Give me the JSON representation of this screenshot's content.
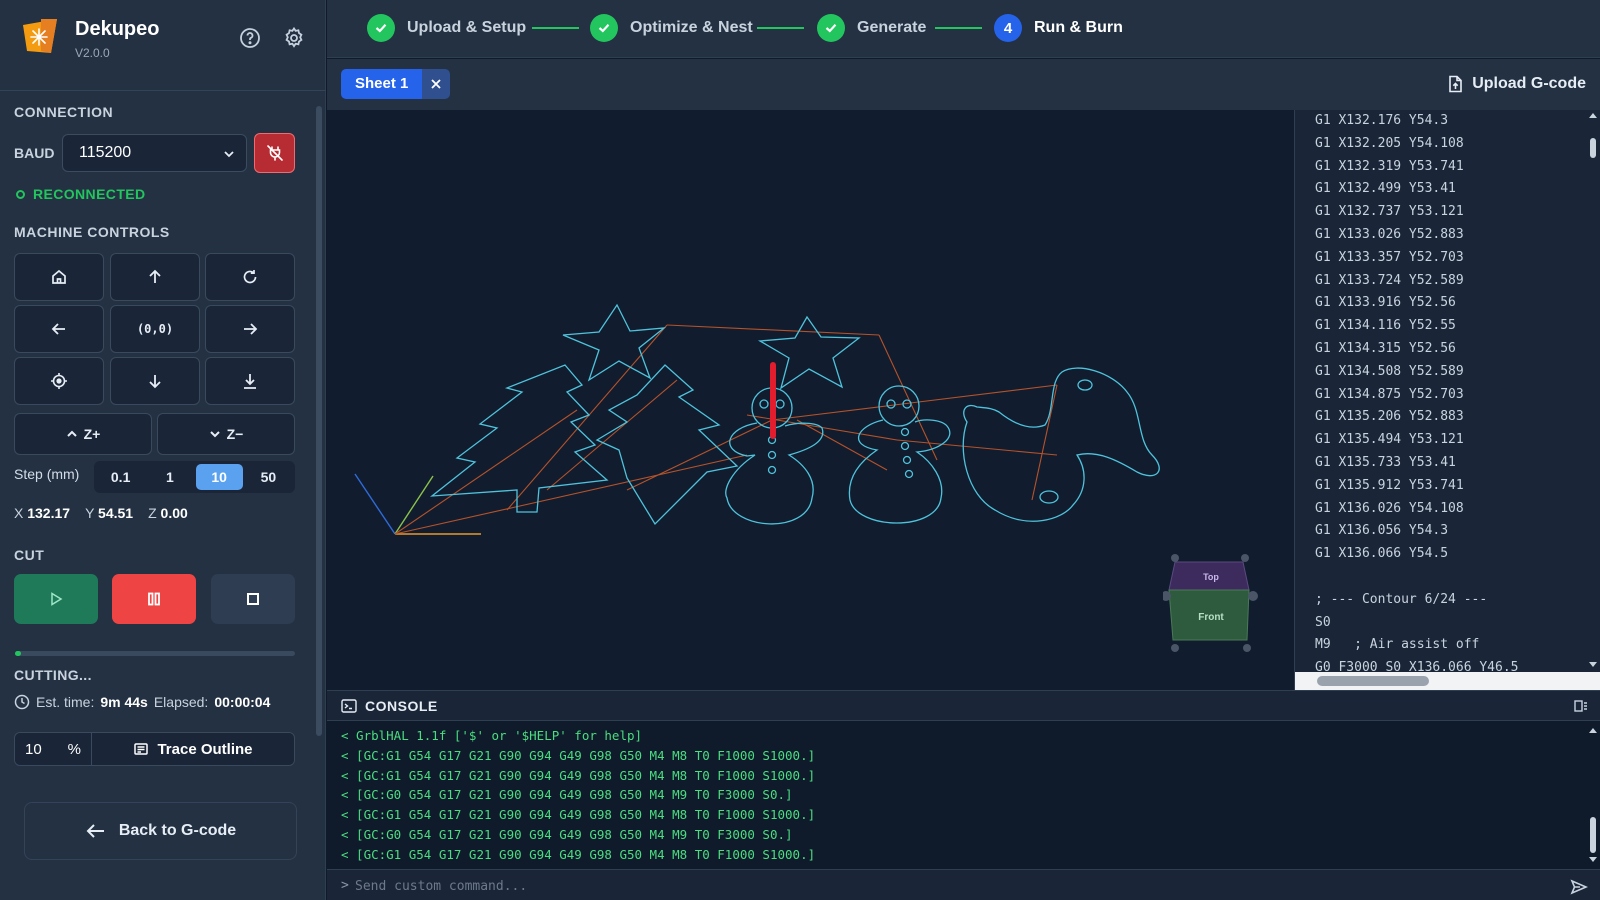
{
  "app": {
    "name": "Dekupeo",
    "version": "V2.0.0"
  },
  "stepper": {
    "steps": [
      {
        "label": "Upload & Setup",
        "state": "done"
      },
      {
        "label": "Optimize & Nest",
        "state": "done"
      },
      {
        "label": "Generate",
        "state": "done"
      },
      {
        "label": "Run & Burn",
        "state": "current",
        "number": "4"
      }
    ]
  },
  "connection": {
    "title": "CONNECTION",
    "baud_label": "BAUD",
    "baud_value": "115200",
    "status": "RECONNECTED"
  },
  "machine": {
    "title": "MACHINE CONTROLS",
    "origin_label": "(0,0)",
    "z_plus": "Z+",
    "z_minus": "Z−",
    "step_label": "Step (mm)",
    "steps": [
      "0.1",
      "1",
      "10",
      "50"
    ],
    "active_step": "10",
    "coords": {
      "x_label": "X",
      "x": "132.17",
      "y_label": "Y",
      "y": "54.51",
      "z_label": "Z",
      "z": "0.00"
    }
  },
  "cut": {
    "title": "CUT",
    "progress": 0.02,
    "status": "CUTTING...",
    "est_label": "Est. time:",
    "est_value": "9m 44s",
    "elapsed_label": "Elapsed:",
    "elapsed_value": "00:00:04",
    "trace_value": "10",
    "trace_unit": "%",
    "trace_label": "Trace Outline"
  },
  "back_label": "Back to G-code",
  "tabs": {
    "sheet_label": "Sheet 1",
    "upload_label": "Upload G-code"
  },
  "viewer": {
    "cube_top": "Top",
    "cube_front": "Front"
  },
  "gcode": {
    "lines": [
      "G1 X132.176 Y54.3",
      "G1 X132.205 Y54.108",
      "G1 X132.319 Y53.741",
      "G1 X132.499 Y53.41",
      "G1 X132.737 Y53.121",
      "G1 X133.026 Y52.883",
      "G1 X133.357 Y52.703",
      "G1 X133.724 Y52.589",
      "G1 X133.916 Y52.56",
      "G1 X134.116 Y52.55",
      "G1 X134.315 Y52.56",
      "G1 X134.508 Y52.589",
      "G1 X134.875 Y52.703",
      "G1 X135.206 Y52.883",
      "G1 X135.494 Y53.121",
      "G1 X135.733 Y53.41",
      "G1 X135.912 Y53.741",
      "G1 X136.026 Y54.108",
      "G1 X136.056 Y54.3",
      "G1 X136.066 Y54.5",
      "",
      "; --- Contour 6/24 ---",
      "S0",
      "M9   ; Air assist off",
      "G0 F3000 S0 X136.066 Y46.5"
    ]
  },
  "console": {
    "title": "CONSOLE",
    "lines": [
      "< GrblHAL 1.1f ['$' or '$HELP' for help]",
      "< [GC:G1 G54 G17 G21 G90 G94 G49 G98 G50 M4 M8 T0 F1000 S1000.]",
      "< [GC:G1 G54 G17 G21 G90 G94 G49 G98 G50 M4 M8 T0 F1000 S1000.]",
      "< [GC:G0 G54 G17 G21 G90 G94 G49 G98 G50 M4 M9 T0 F3000 S0.]",
      "< [GC:G1 G54 G17 G21 G90 G94 G49 G98 G50 M4 M8 T0 F1000 S1000.]",
      "< [GC:G0 G54 G17 G21 G90 G94 G49 G98 G50 M4 M9 T0 F3000 S0.]",
      "< [GC:G1 G54 G17 G21 G90 G94 G49 G98 G50 M4 M8 T0 F1000 S1000.]"
    ],
    "prompt": ">",
    "placeholder": "Send custom command..."
  },
  "colors": {
    "accent": "#2563eb",
    "success": "#22c55e",
    "danger": "#ef4444",
    "toolpath": "#4fc3dc",
    "travel": "#b5532a",
    "laser": "#e11d2e"
  }
}
